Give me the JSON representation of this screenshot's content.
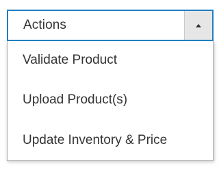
{
  "actions_dropdown": {
    "label": "Actions",
    "arrow_icon": "chevron-up-icon",
    "accent_color": "#1f7fc2",
    "items": [
      {
        "label": "Validate Product"
      },
      {
        "label": "Upload Product(s)"
      },
      {
        "label": "Update Inventory & Price"
      }
    ]
  }
}
